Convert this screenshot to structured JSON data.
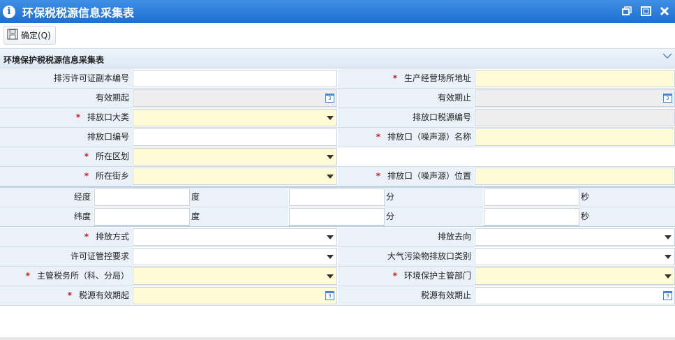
{
  "window": {
    "title": "环保税税源信息采集表",
    "info_icon": "i"
  },
  "toolbar": {
    "confirm_label": "确定(Q)"
  },
  "section": {
    "title": "环境保护税税源信息采集表"
  },
  "required_mark": "*",
  "form": {
    "permit_copy_no": "排污许可证副本编号",
    "business_address": "生产经营场所地址",
    "valid_from": "有效期起",
    "valid_to": "有效期止",
    "outlet_category": "排放口大类",
    "outlet_tax_source_no": "排放口税源编号",
    "outlet_no": "排放口编号",
    "outlet_name": "排放口（噪声源）名称",
    "district": "所在区划",
    "street": "所在街乡",
    "outlet_location": "排放口（噪声源）位置",
    "longitude": "经度",
    "latitude": "纬度",
    "degree": "度",
    "minute": "分",
    "second": "秒",
    "discharge_method": "排放方式",
    "discharge_destination": "排放去向",
    "permit_control": "许可证管控要求",
    "air_outlet_type": "大气污染物排放口类别",
    "tax_office": "主管税务所（科、分局）",
    "env_dept": "环境保护主管部门",
    "source_valid_from": "税源有效期起",
    "source_valid_to": "税源有效期止"
  },
  "colors": {
    "titlebar": "#1f6fd1",
    "label_bg": "#eaf1f9",
    "required_field": "#fffbd6",
    "disabled_field": "#eeeeee",
    "required_mark": "#d01818"
  }
}
